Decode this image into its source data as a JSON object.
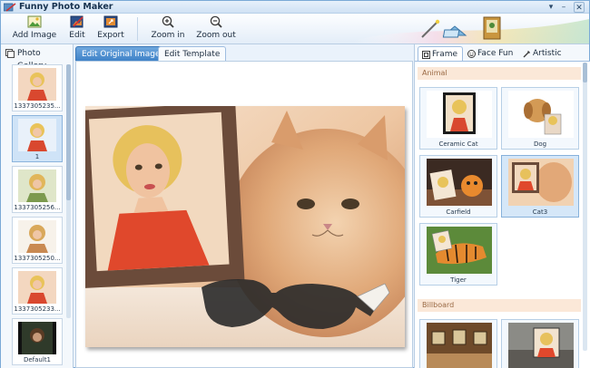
{
  "window": {
    "title": "Funny Photo Maker",
    "controls": [
      "▾",
      "–",
      "✕"
    ]
  },
  "toolbar": {
    "buttons": [
      {
        "label": "Add Image",
        "icon": "add-image-icon"
      },
      {
        "label": "Edit",
        "icon": "edit-icon"
      },
      {
        "label": "Export",
        "icon": "export-icon"
      },
      {
        "label": "Zoom in",
        "icon": "zoom-in-icon"
      },
      {
        "label": "Zoom out",
        "icon": "zoom-out-icon"
      }
    ]
  },
  "gallery": {
    "tab_label": "Photo Gallery",
    "items": [
      {
        "caption": "1337305235..."
      },
      {
        "caption": "1",
        "selected": true
      },
      {
        "caption": "1337305256..."
      },
      {
        "caption": "1337305250..."
      },
      {
        "caption": "1337305233..."
      },
      {
        "caption": "Default1"
      }
    ]
  },
  "editor": {
    "tabs": [
      "Edit Original Image",
      "Edit Template"
    ],
    "active_tab": "Edit Original Image"
  },
  "templates": {
    "tabs": [
      "Frame",
      "Face Fun",
      "Artistic"
    ],
    "active_tab": "Frame",
    "categories": [
      {
        "name": "Animal",
        "items": [
          "Ceramic Cat",
          "Dog",
          "Carfield",
          "Cat3",
          "Tiger"
        ],
        "selected": "Cat3"
      },
      {
        "name": "Billboard",
        "items": [
          "",
          ""
        ]
      }
    ]
  },
  "colors": {
    "accent": "#3f82c8",
    "category_header": "#fbe8d8",
    "window_border": "#7aa9d6"
  }
}
